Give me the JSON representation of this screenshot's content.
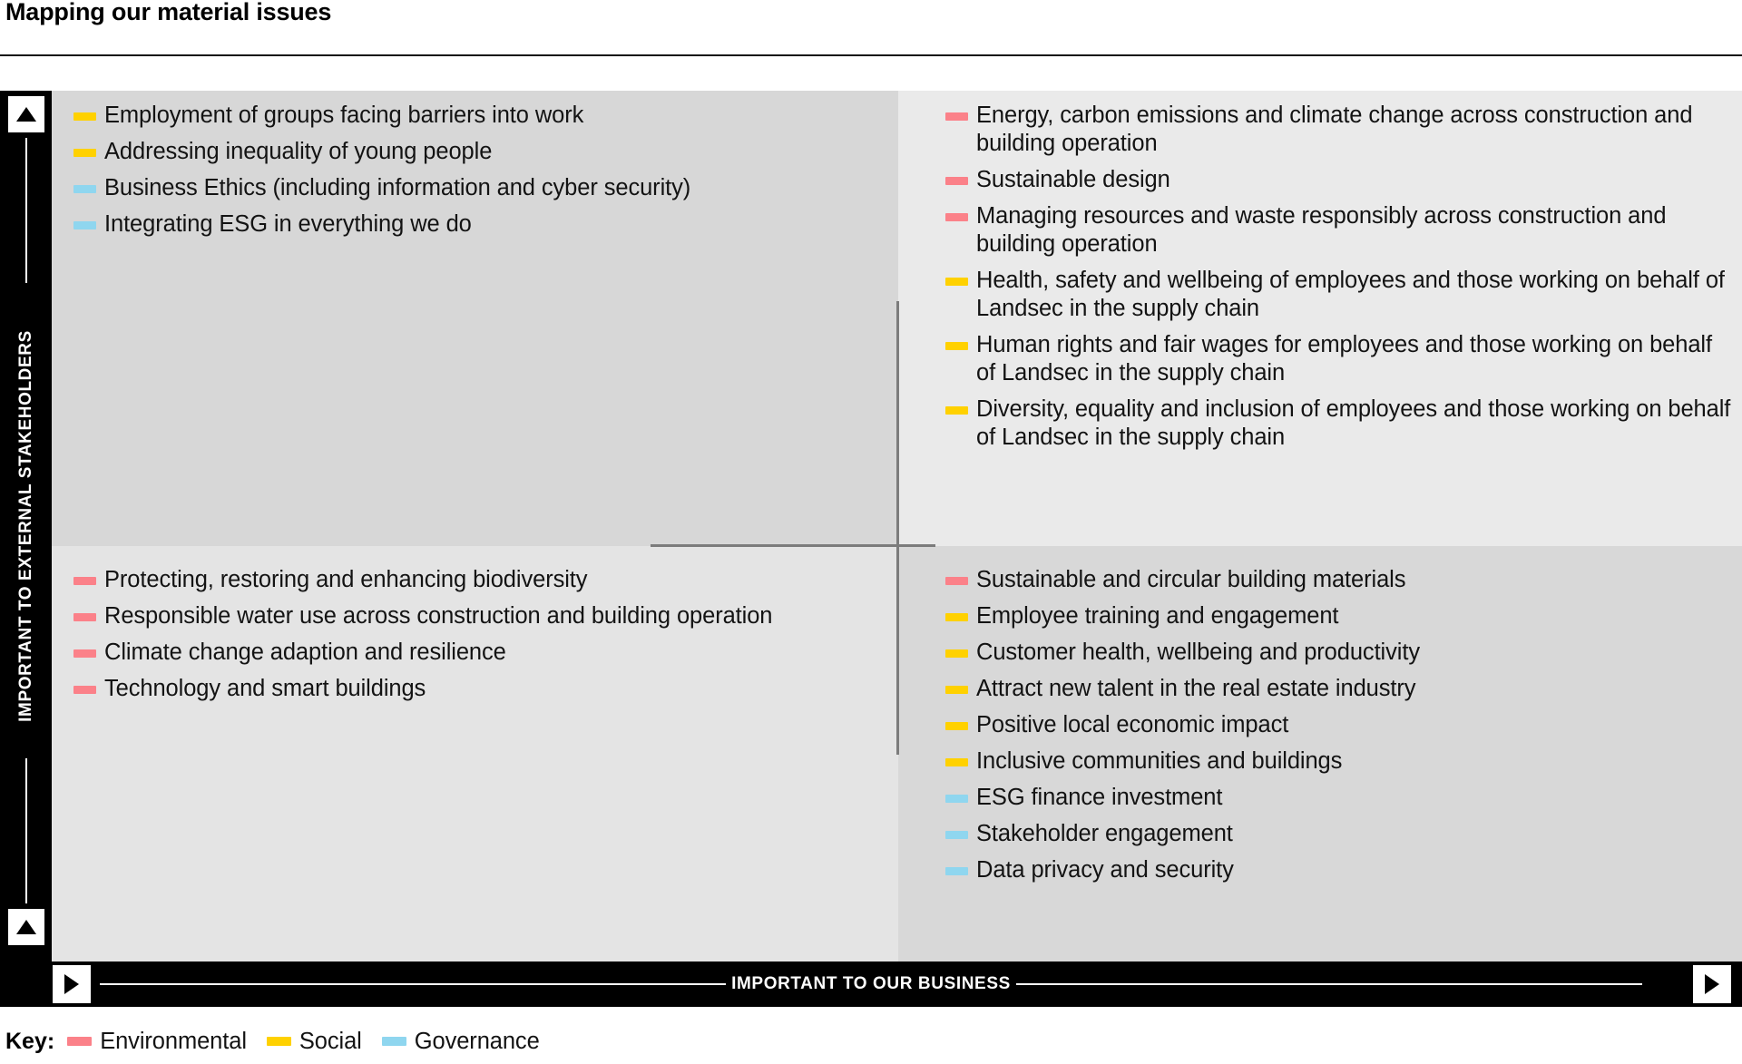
{
  "header": {
    "title": "Mapping our material issues"
  },
  "axes": {
    "y_label": "IMPORTANT TO EXTERNAL STAKEHOLDERS",
    "x_label": "IMPORTANT TO OUR BUSINESS",
    "y_arrow_icon": "triangle-up-icon",
    "x_arrow_icon": "triangle-right-icon"
  },
  "colors": {
    "environmental": "#fb8189",
    "social": "#ffd100",
    "governance": "#8fd6ef",
    "quadrant_top_left": "#d7d7d7",
    "quadrant_top_right": "#eaeaea",
    "quadrant_bottom_left": "#e4e4e4",
    "quadrant_bottom_right": "#d8d8d8",
    "axis_bar": "#000000",
    "divider": "#7c7c7c"
  },
  "key": {
    "title": "Key:",
    "entries": [
      {
        "label": "Environmental",
        "color": "#fb8189",
        "category": "environmental"
      },
      {
        "label": "Social",
        "color": "#ffd100",
        "category": "social"
      },
      {
        "label": "Governance",
        "color": "#8fd6ef",
        "category": "governance"
      }
    ]
  },
  "chart_data": {
    "type": "table",
    "title": "Mapping our material issues",
    "xlabel": "IMPORTANT TO OUR BUSINESS",
    "ylabel": "IMPORTANT TO EXTERNAL STAKEHOLDERS",
    "legend": [
      "Environmental",
      "Social",
      "Governance"
    ],
    "quadrants": [
      {
        "id": "top-left",
        "x": "lower",
        "y": "higher",
        "items": [
          {
            "label": "Employment of groups facing barriers into work",
            "category": "social",
            "color": "#ffd100"
          },
          {
            "label": "Addressing inequality of young people",
            "category": "social",
            "color": "#ffd100"
          },
          {
            "label": "Business Ethics (including information and cyber security)",
            "category": "governance",
            "color": "#8fd6ef"
          },
          {
            "label": "Integrating ESG in everything we do",
            "category": "governance",
            "color": "#8fd6ef"
          }
        ]
      },
      {
        "id": "top-right",
        "x": "higher",
        "y": "higher",
        "items": [
          {
            "label": "Energy, carbon emissions and climate change across construction and building operation",
            "category": "environmental",
            "color": "#fb8189"
          },
          {
            "label": "Sustainable design",
            "category": "environmental",
            "color": "#fb8189"
          },
          {
            "label": "Managing resources and waste responsibly across construction and building operation",
            "category": "environmental",
            "color": "#fb8189"
          },
          {
            "label": "Health, safety and wellbeing of employees and those working on behalf of Landsec in the supply chain",
            "category": "social",
            "color": "#ffd100"
          },
          {
            "label": "Human rights and fair wages for employees and those working on behalf of Landsec in the supply chain",
            "category": "social",
            "color": "#ffd100"
          },
          {
            "label": "Diversity, equality and inclusion of employees and those working on behalf of Landsec in the supply chain",
            "category": "social",
            "color": "#ffd100"
          }
        ]
      },
      {
        "id": "bottom-left",
        "x": "lower",
        "y": "lower",
        "items": [
          {
            "label": "Protecting, restoring and enhancing biodiversity",
            "category": "environmental",
            "color": "#fb8189"
          },
          {
            "label": "Responsible water use across construction and building operation",
            "category": "environmental",
            "color": "#fb8189"
          },
          {
            "label": "Climate change adaption and resilience",
            "category": "environmental",
            "color": "#fb8189"
          },
          {
            "label": "Technology and smart buildings",
            "category": "environmental",
            "color": "#fb8189"
          }
        ]
      },
      {
        "id": "bottom-right",
        "x": "higher",
        "y": "lower",
        "items": [
          {
            "label": "Sustainable and circular building materials",
            "category": "environmental",
            "color": "#fb8189"
          },
          {
            "label": "Employee training and engagement",
            "category": "social",
            "color": "#ffd100"
          },
          {
            "label": "Customer health, wellbeing and productivity",
            "category": "social",
            "color": "#ffd100"
          },
          {
            "label": "Attract new talent in the real estate industry",
            "category": "social",
            "color": "#ffd100"
          },
          {
            "label": "Positive local economic impact",
            "category": "social",
            "color": "#ffd100"
          },
          {
            "label": "Inclusive communities and buildings",
            "category": "social",
            "color": "#ffd100"
          },
          {
            "label": "ESG finance investment",
            "category": "governance",
            "color": "#8fd6ef"
          },
          {
            "label": "Stakeholder engagement",
            "category": "governance",
            "color": "#8fd6ef"
          },
          {
            "label": "Data privacy and security",
            "category": "governance",
            "color": "#8fd6ef"
          }
        ]
      }
    ]
  }
}
